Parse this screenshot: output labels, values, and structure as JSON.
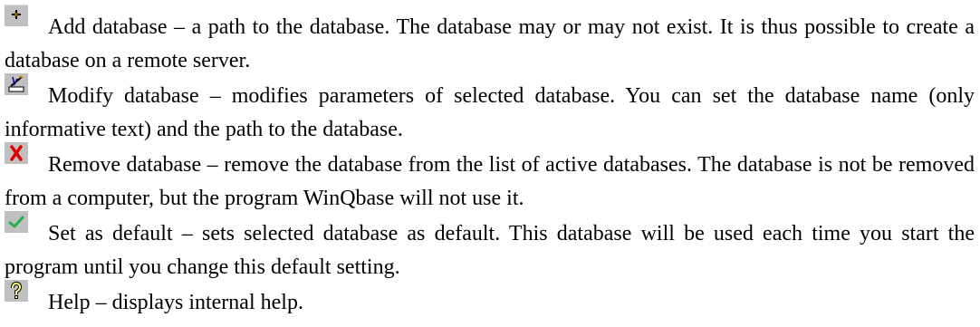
{
  "items": [
    {
      "icon": "add-database-icon",
      "text": "Add database – a path to the database. The database may or may not exist. It is thus possible to create a database on a remote server."
    },
    {
      "icon": "modify-database-icon",
      "text": "Modify database – modifies parameters of selected database. You can set the database name (only informative text) and the path to the database."
    },
    {
      "icon": "remove-database-icon",
      "text": "Remove database – remove the database from the list of active databases. The database is not be removed from a computer, but the program WinQbase will not use it."
    },
    {
      "icon": "set-default-icon",
      "text": "Set as default – sets selected database as default. This database will be used each time you start the program until you change this default setting."
    },
    {
      "icon": "help-icon",
      "text": "Help – displays internal help."
    }
  ],
  "colors": {
    "icon_background": "#c0c0c0",
    "remove_red": "#e00000",
    "check_green": "#22b14c",
    "help_yellow": "#ffff80"
  }
}
